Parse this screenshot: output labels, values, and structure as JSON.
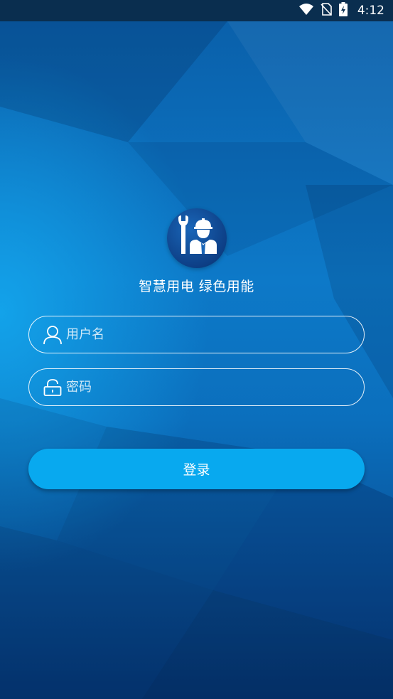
{
  "status_bar": {
    "time": "4:12",
    "icons": [
      "wifi-icon",
      "no-sim-icon",
      "battery-charging-icon"
    ]
  },
  "logo": {
    "icon": "repair-worker-icon"
  },
  "slogan": "智慧用电 绿色用能",
  "form": {
    "username": {
      "placeholder": "用户名",
      "value": "",
      "icon": "user-icon"
    },
    "password": {
      "placeholder": "密码",
      "value": "",
      "icon": "lock-icon"
    },
    "login_label": "登录"
  },
  "colors": {
    "button": "#08a9ef",
    "background": "#0b6fbd",
    "status_bar": "#0a2e4f"
  }
}
